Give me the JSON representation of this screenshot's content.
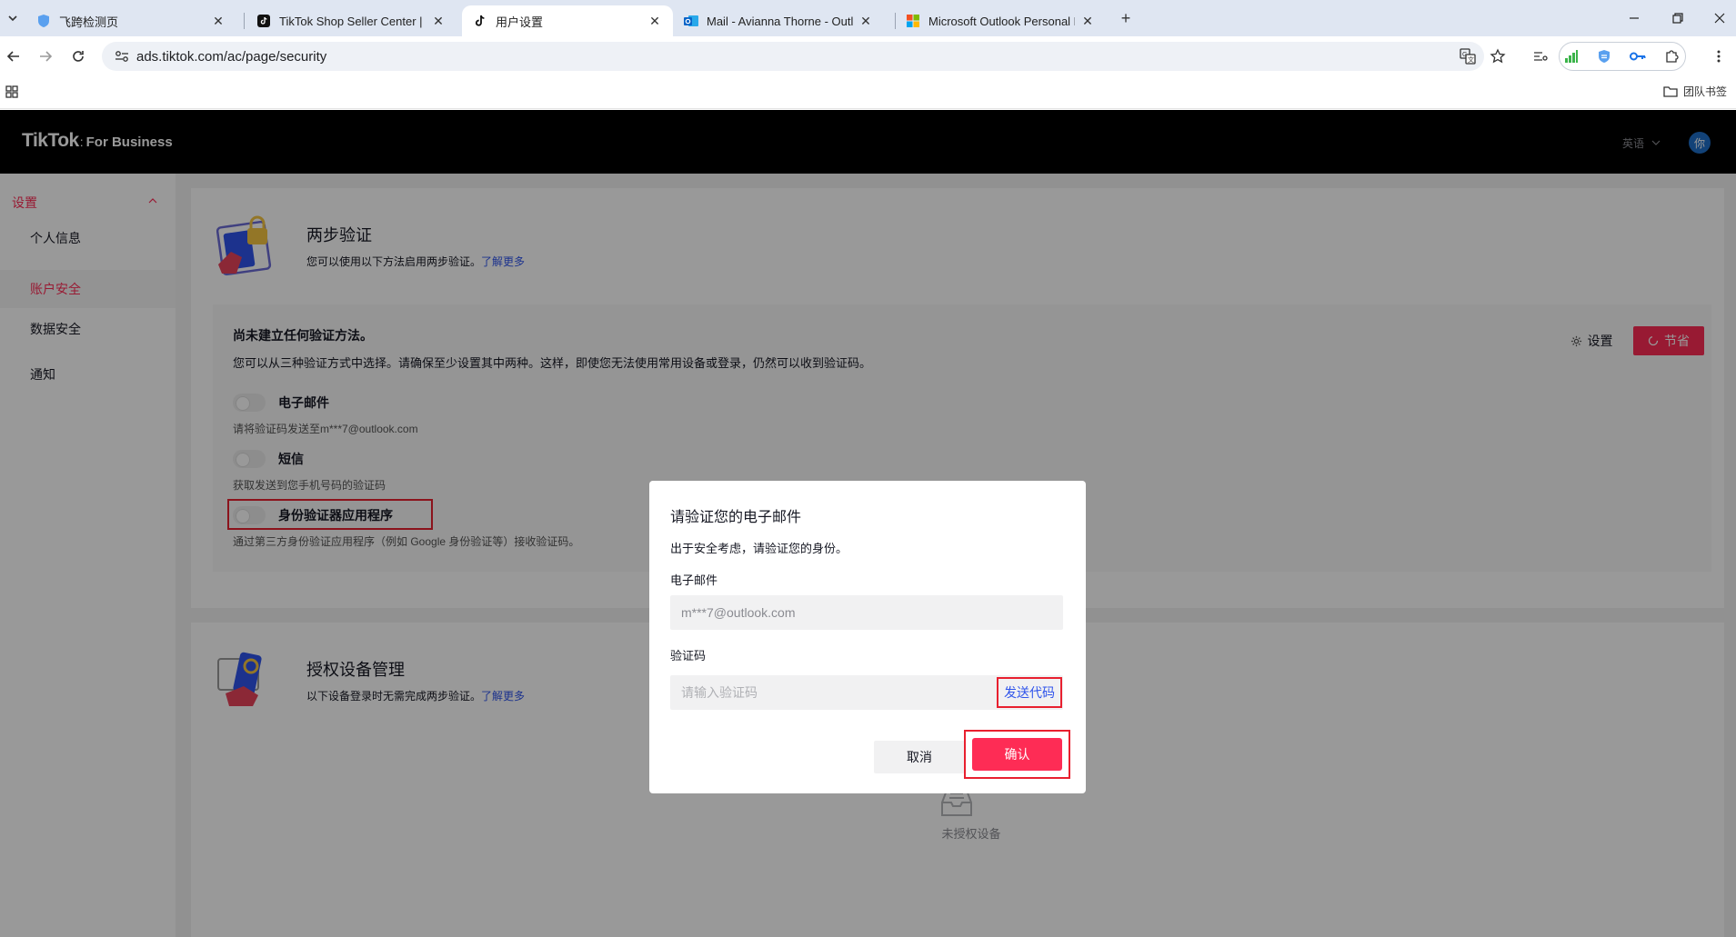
{
  "browser": {
    "tabs": [
      {
        "title": "飞跨检测页",
        "icon": "shield-icon"
      },
      {
        "title": "TikTok Shop Seller Center | Ti",
        "icon": "tiktok-icon"
      },
      {
        "title": "用户设置",
        "icon": "tiktok-icon"
      },
      {
        "title": "Mail - Avianna Thorne - Outl",
        "icon": "outlook-icon"
      },
      {
        "title": "Microsoft Outlook Personal E",
        "icon": "microsoft-icon"
      }
    ],
    "active_tab": 2,
    "url": "ads.tiktok.com/ac/page/security",
    "bookmark_folder": "团队书签"
  },
  "header": {
    "logo_main": "TikTok",
    "logo_sub": "For Business",
    "language": "英语",
    "avatar_text": "你"
  },
  "sidebar": {
    "section": "设置",
    "items": [
      {
        "label": "个人信息",
        "active": false
      },
      {
        "label": "账户安全",
        "active": true
      },
      {
        "label": "数据安全",
        "active": false
      },
      {
        "label": "通知",
        "active": false
      }
    ]
  },
  "two_step": {
    "title": "两步验证",
    "desc": "您可以使用以下方法启用两步验证。",
    "learn_more": "了解更多",
    "status_heading": "尚未建立任何验证方法。",
    "status_desc": "您可以从三种验证方式中选择。请确保至少设置其中两种。这样，即使您无法使用常用设备或登录，仍然可以收到验证码。",
    "settings_btn": "设置",
    "save_btn": "节省",
    "options": [
      {
        "label": "电子邮件",
        "sub": "请将验证码发送至m***7@outlook.com",
        "enabled": false
      },
      {
        "label": "短信",
        "sub": "获取发送到您手机号码的验证码",
        "enabled": false
      },
      {
        "label": "身份验证器应用程序",
        "sub": "通过第三方身份验证应用程序（例如 Google 身份验证等）接收验证码。",
        "enabled": false
      }
    ]
  },
  "devices": {
    "title": "授权设备管理",
    "desc": "以下设备登录时无需完成两步验证。",
    "learn_more": "了解更多",
    "empty": "未授权设备"
  },
  "modal": {
    "title": "请验证您的电子邮件",
    "subtitle": "出于安全考虑，请验证您的身份。",
    "email_label": "电子邮件",
    "email_value": "m***7@outlook.com",
    "code_label": "验证码",
    "code_placeholder": "请输入验证码",
    "send_code": "发送代码",
    "cancel": "取消",
    "confirm": "确认"
  },
  "colors": {
    "brand": "#fe2c55",
    "link": "#2f54eb",
    "highlight": "#e8202f",
    "nav_bg": "#000000"
  }
}
